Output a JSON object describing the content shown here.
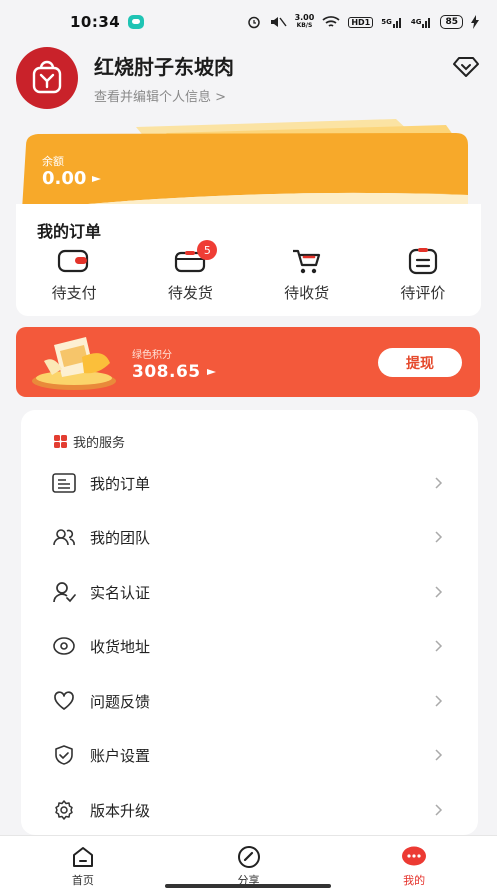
{
  "status_bar": {
    "time": "10:34",
    "net_speed_top": "3.00",
    "net_speed_unit": "KB/S",
    "hd": "HD1",
    "sig1": "5G",
    "sig2": "4G",
    "battery": "85"
  },
  "profile": {
    "name": "红烧肘子东坡肉",
    "edit_hint": "查看并编辑个人信息 >"
  },
  "balance": {
    "label": "余额",
    "value": "0.00"
  },
  "orders": {
    "title": "我的订单",
    "items": [
      {
        "label": "待支付",
        "icon": "wallet-icon"
      },
      {
        "label": "待发货",
        "icon": "box-icon",
        "badge": "5"
      },
      {
        "label": "待收货",
        "icon": "cart-icon"
      },
      {
        "label": "待评价",
        "icon": "comment-icon"
      }
    ]
  },
  "points": {
    "label": "绿色积分",
    "value": "308.65",
    "withdraw_label": "提现"
  },
  "services": {
    "title": "我的服务",
    "items": [
      {
        "label": "我的订单",
        "icon": "order-list-icon"
      },
      {
        "label": "我的团队",
        "icon": "team-icon"
      },
      {
        "label": "实名认证",
        "icon": "verify-user-icon"
      },
      {
        "label": "收货地址",
        "icon": "location-icon"
      },
      {
        "label": "问题反馈",
        "icon": "heart-icon"
      },
      {
        "label": "账户设置",
        "icon": "shield-icon"
      },
      {
        "label": "版本升级",
        "icon": "gear-icon"
      }
    ]
  },
  "nav": {
    "items": [
      {
        "label": "首页",
        "icon": "home-icon"
      },
      {
        "label": "分享",
        "icon": "gauge-icon"
      },
      {
        "label": "我的",
        "icon": "chat-bubble-icon"
      }
    ]
  },
  "colors": {
    "brand_red": "#c9222a",
    "accent_orange": "#f5a623",
    "points_red": "#f3593b"
  }
}
